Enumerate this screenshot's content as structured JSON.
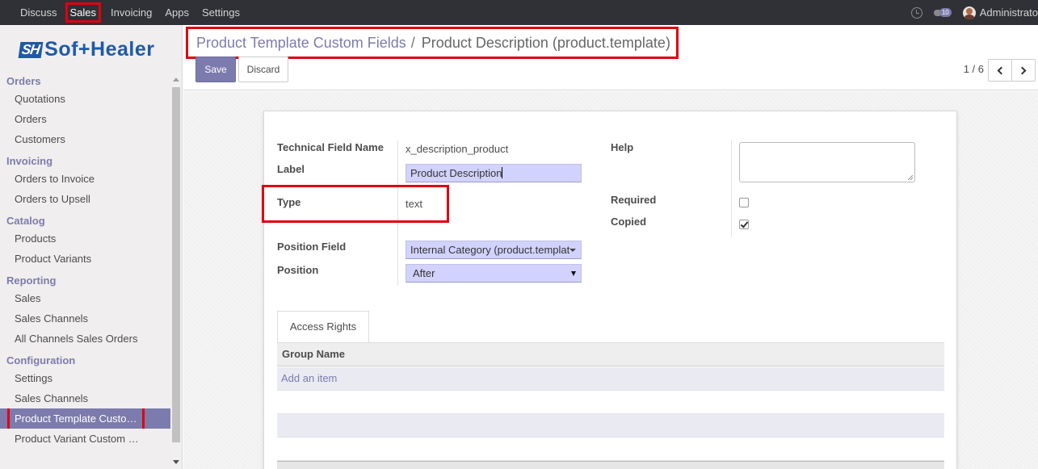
{
  "topbar": {
    "menu": [
      "Discuss",
      "Sales",
      "Invoicing",
      "Apps",
      "Settings"
    ],
    "chat_count": "10",
    "user": "Administrato"
  },
  "sidebar": {
    "logo": {
      "mark": "SH",
      "text": "Sof+Healer"
    },
    "sections": [
      {
        "title": "Orders",
        "items": [
          "Quotations",
          "Orders",
          "Customers"
        ]
      },
      {
        "title": "Invoicing",
        "items": [
          "Orders to Invoice",
          "Orders to Upsell"
        ]
      },
      {
        "title": "Catalog",
        "items": [
          "Products",
          "Product Variants"
        ]
      },
      {
        "title": "Reporting",
        "items": [
          "Sales",
          "Sales Channels",
          "All Channels Sales Orders"
        ]
      },
      {
        "title": "Configuration",
        "items": [
          "Settings",
          "Sales Channels",
          "Product Template Custo…",
          "Product Variant Custom …"
        ]
      }
    ]
  },
  "breadcrumb": {
    "parent": "Product Template Custom Fields",
    "separator": "/",
    "current": "Product Description (product.template)"
  },
  "actions": {
    "save": "Save",
    "discard": "Discard"
  },
  "pager": {
    "value": "1 / 6"
  },
  "form": {
    "technical_field_name_label": "Technical Field Name",
    "technical_field_name_value": "x_description_product",
    "label_label": "Label",
    "label_value": "Product Description",
    "type_label": "Type",
    "type_value": "text",
    "position_field_label": "Position Field",
    "position_field_value": "Internal Category (product.templat",
    "position_label": "Position",
    "position_value": "After",
    "help_label": "Help",
    "help_value": "",
    "required_label": "Required",
    "required_checked": false,
    "copied_label": "Copied",
    "copied_checked": true
  },
  "tabs": {
    "access_rights": "Access Rights"
  },
  "grid": {
    "column": "Group Name",
    "add_item": "Add an item"
  },
  "colors": {
    "accent": "#7c7bad",
    "highlight": "#e0000f",
    "navbar": "#2f3136",
    "input_bg": "#d2d2ff"
  }
}
